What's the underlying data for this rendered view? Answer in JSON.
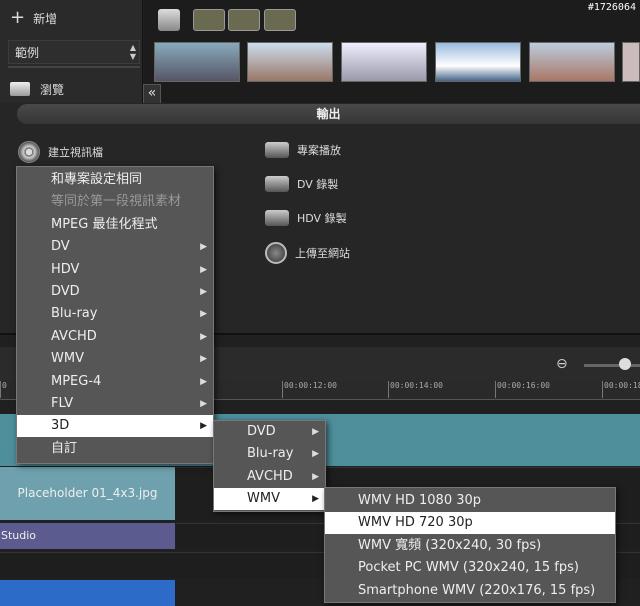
{
  "watermark": "#1726064",
  "library": {
    "add_label": "新增",
    "folder_select": "範例",
    "browse_label": "瀏覽",
    "collapse_icon": "«"
  },
  "output": {
    "header": "輸出",
    "create_video": "建立視訊檔",
    "project_playback": "專案播放",
    "dv_record": "DV 錄製",
    "hdv_record": "HDV 錄製",
    "upload_web": "上傳至網站"
  },
  "timeline": {
    "ruler_ticks": [
      "00:00:12:00",
      "00:00:14:00",
      "00:00:16:00",
      "00:00:18:0"
    ],
    "ruler_start": "0",
    "clip_placeholder": "Placeholder 01_4x3.jpg",
    "clip_studio": "Studio"
  },
  "menu_main": {
    "items": [
      {
        "label": "和專案設定相同",
        "disabled": false,
        "sub": false
      },
      {
        "label": "等同於第一段視訊素材",
        "disabled": true,
        "sub": false
      },
      {
        "label": "MPEG 最佳化程式",
        "disabled": false,
        "sub": false
      },
      {
        "label": "DV",
        "disabled": false,
        "sub": true
      },
      {
        "label": "HDV",
        "disabled": false,
        "sub": true
      },
      {
        "label": "DVD",
        "disabled": false,
        "sub": true
      },
      {
        "label": "Blu-ray",
        "disabled": false,
        "sub": true
      },
      {
        "label": "AVCHD",
        "disabled": false,
        "sub": true
      },
      {
        "label": "WMV",
        "disabled": false,
        "sub": true
      },
      {
        "label": "MPEG-4",
        "disabled": false,
        "sub": true
      },
      {
        "label": "FLV",
        "disabled": false,
        "sub": true
      },
      {
        "label": "3D",
        "disabled": false,
        "sub": true,
        "selected": true
      },
      {
        "label": "自訂",
        "disabled": false,
        "sub": false
      }
    ]
  },
  "menu_3d": {
    "items": [
      {
        "label": "DVD",
        "sub": true
      },
      {
        "label": "Blu-ray",
        "sub": true
      },
      {
        "label": "AVCHD",
        "sub": true
      },
      {
        "label": "WMV",
        "sub": true,
        "selected": true
      }
    ]
  },
  "menu_wmv": {
    "items": [
      {
        "label": "WMV HD 1080 30p"
      },
      {
        "label": "WMV HD 720 30p",
        "selected": true
      },
      {
        "label": "WMV 寬頻 (320x240, 30 fps)"
      },
      {
        "label": "Pocket PC WMV (320x240, 15 fps)"
      },
      {
        "label": "Smartphone WMV (220x176, 15 fps)"
      }
    ]
  },
  "colors": {
    "accent_track": "#4f8f9c",
    "clip": "#6ea1ad",
    "studio": "#5b5b8f"
  }
}
